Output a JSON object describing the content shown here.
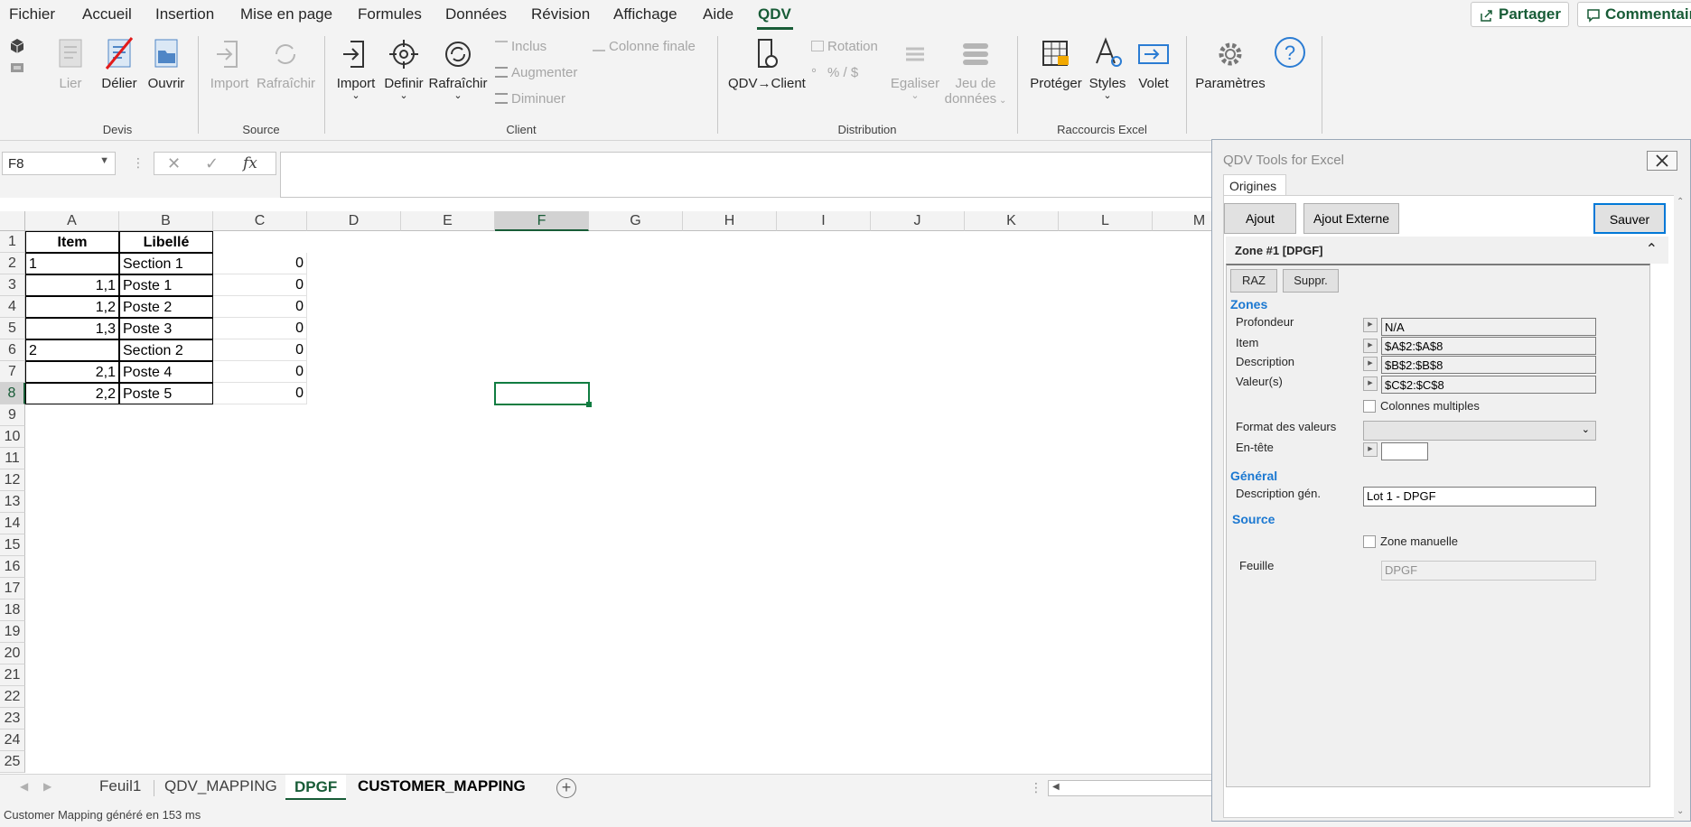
{
  "menu": {
    "items": [
      "Fichier",
      "Accueil",
      "Insertion",
      "Mise en page",
      "Formules",
      "Données",
      "Révision",
      "Affichage",
      "Aide",
      "QDV"
    ],
    "share": "Partager",
    "comments": "Commentair"
  },
  "ribbon": {
    "devis": {
      "lier": "Lier",
      "delier": "Délier",
      "ouvrir": "Ouvrir",
      "group": "Devis"
    },
    "source": {
      "import": "Import",
      "rafraichir": "Rafraîchir",
      "group": "Source"
    },
    "client": {
      "import": "Import",
      "definir": "Definir",
      "rafraichir": "Rafraîchir",
      "inclus": "Inclus",
      "augmenter": "Augmenter",
      "diminuer": "Diminuer",
      "colonne_finale": "Colonne finale",
      "group": "Client"
    },
    "distribution": {
      "qdv_client": "QDV→Client",
      "rotation": "Rotation",
      "percent": "% / $",
      "egaliser": "Egaliser",
      "jeu1": "Jeu de",
      "jeu2": "données",
      "group": "Distribution"
    },
    "raccourcis": {
      "proteger": "Protéger",
      "styles": "Styles",
      "volet": "Volet",
      "group": "Raccourcis Excel"
    },
    "parametres": {
      "label": "Paramètres"
    }
  },
  "formula_bar": {
    "namebox": "F8",
    "fx": "fx",
    "value": ""
  },
  "grid": {
    "columns": [
      "A",
      "B",
      "C",
      "D",
      "E",
      "F",
      "G",
      "H",
      "I",
      "J",
      "K",
      "L",
      "M"
    ],
    "selected_column": "F",
    "selected_row": "8",
    "rows": [
      "1",
      "2",
      "3",
      "4",
      "5",
      "6",
      "7",
      "8",
      "9",
      "10",
      "11",
      "12",
      "13",
      "14",
      "15",
      "16",
      "17",
      "18",
      "19",
      "20",
      "21",
      "22",
      "23",
      "24",
      "25"
    ],
    "cells": {
      "a1": "Item",
      "b1": "Libellé",
      "a2": "1",
      "b2": "Section 1",
      "c2": "0",
      "a3": "1,1",
      "b3": "Poste 1",
      "c3": "0",
      "a4": "1,2",
      "b4": "Poste 2",
      "c4": "0",
      "a5": "1,3",
      "b5": "Poste 3",
      "c5": "0",
      "a6": "2",
      "b6": "Section 2",
      "c6": "0",
      "a7": "2,1",
      "b7": "Poste 4",
      "c7": "0",
      "a8": "2,2",
      "b8": "Poste 5",
      "c8": "0"
    }
  },
  "sheets": {
    "tabs": [
      "Feuil1",
      "QDV_MAPPING",
      "DPGF",
      "CUSTOMER_MAPPING"
    ],
    "active": "DPGF"
  },
  "status": {
    "text": "Customer Mapping généré en 153 ms"
  },
  "pane": {
    "title": "QDV Tools for Excel",
    "tab": "Origines",
    "buttons": {
      "ajout": "Ajout",
      "ajout_externe": "Ajout Externe",
      "sauver": "Sauver"
    },
    "zone_header": "Zone #1 [DPGF]",
    "raz": "RAZ",
    "suppr": "Suppr.",
    "sections": {
      "zones": "Zones",
      "general": "Général",
      "source": "Source"
    },
    "fields": {
      "profondeur_label": "Profondeur",
      "profondeur": "N/A",
      "item_label": "Item",
      "item": "$A$2:$A$8",
      "description_label": "Description",
      "description": "$B$2:$B$8",
      "valeurs_label": "Valeur(s)",
      "valeurs": "$C$2:$C$8",
      "colonnes_multiples": "Colonnes multiples",
      "format_label": "Format des valeurs",
      "format": "",
      "entete_label": "En-tête",
      "entete": "",
      "desc_gen_label": "Description gén.",
      "desc_gen": "Lot 1 - DPGF",
      "zone_manuelle": "Zone manuelle",
      "feuille_label": "Feuille",
      "feuille": "DPGF"
    }
  },
  "colors": {
    "accent": "#185c37",
    "selection": "#107c41",
    "pane_blue": "#1b78d1"
  }
}
